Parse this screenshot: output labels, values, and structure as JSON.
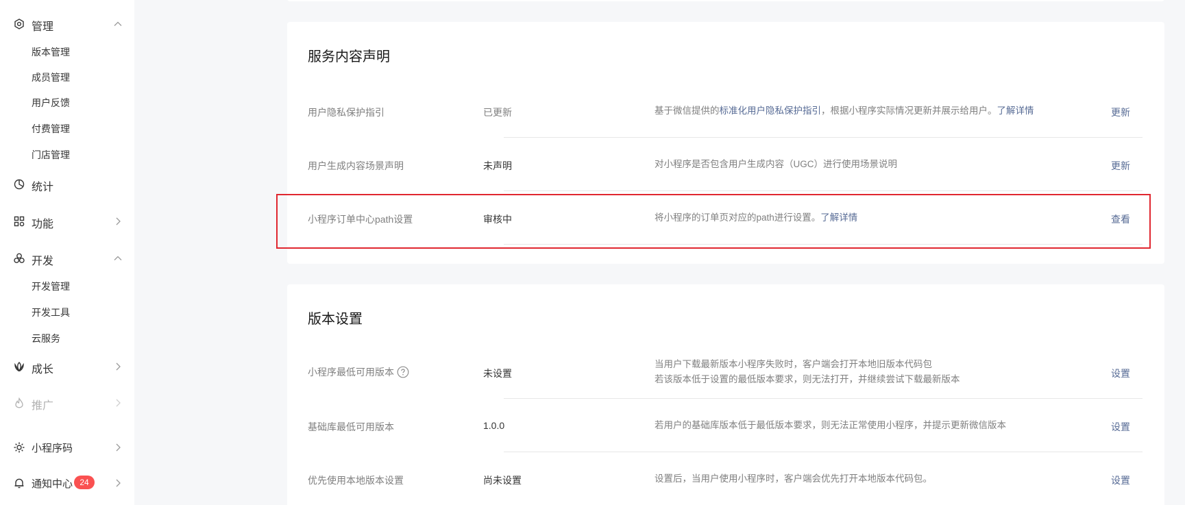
{
  "sidebar": {
    "manage": {
      "label": "管理",
      "items": [
        "版本管理",
        "成员管理",
        "用户反馈",
        "付费管理",
        "门店管理"
      ]
    },
    "stats": {
      "label": "统计"
    },
    "features": {
      "label": "功能"
    },
    "dev": {
      "label": "开发",
      "items": [
        "开发管理",
        "开发工具",
        "云服务"
      ]
    },
    "growth": {
      "label": "成长"
    },
    "promo": {
      "label": "推广"
    },
    "qrcode": {
      "label": "小程序码"
    },
    "notify": {
      "label": "通知中心",
      "badge": "24"
    }
  },
  "service_section": {
    "title": "服务内容声明",
    "rows": [
      {
        "label": "用户隐私保护指引",
        "status": "已更新",
        "desc_prefix": "基于微信提供的",
        "desc_link": "标准化用户隐私保护指引",
        "desc_suffix": "，根据小程序实际情况更新并展示给用户。",
        "desc_more": "了解详情",
        "action": "更新"
      },
      {
        "label": "用户生成内容场景声明",
        "status": "未声明",
        "desc": "对小程序是否包含用户生成内容（UGC）进行使用场景说明",
        "action": "更新"
      },
      {
        "label": "小程序订单中心path设置",
        "status": "审核中",
        "desc": "将小程序的订单页对应的path进行设置。",
        "desc_more": "了解详情",
        "action": "查看"
      }
    ]
  },
  "version_section": {
    "title": "版本设置",
    "rows": [
      {
        "label": "小程序最低可用版本",
        "status": "未设置",
        "desc_line1": "当用户下载最新版本小程序失败时，客户端会打开本地旧版本代码包",
        "desc_line2": "若该版本低于设置的最低版本要求，则无法打开，并继续尝试下载最新版本",
        "action": "设置"
      },
      {
        "label": "基础库最低可用版本",
        "status": "1.0.0",
        "desc": "若用户的基础库版本低于最低版本要求，则无法正常使用小程序，并提示更新微信版本",
        "action": "设置"
      },
      {
        "label": "优先使用本地版本设置",
        "status": "尚未设置",
        "desc": "设置后，当用户使用小程序时，客户端会优先打开本地版本代码包。",
        "action": "设置"
      }
    ]
  },
  "colors": {
    "link": "#576b95",
    "highlight": "#e0262f",
    "badge": "#fa5151"
  },
  "icons": {
    "manage": "settings-hexagon-icon",
    "stats": "pie-chart-icon",
    "features": "grid-icon",
    "dev": "clover-icon",
    "growth": "lotus-icon",
    "promo": "flame-icon",
    "qrcode": "sun-icon",
    "notify": "bell-icon"
  }
}
